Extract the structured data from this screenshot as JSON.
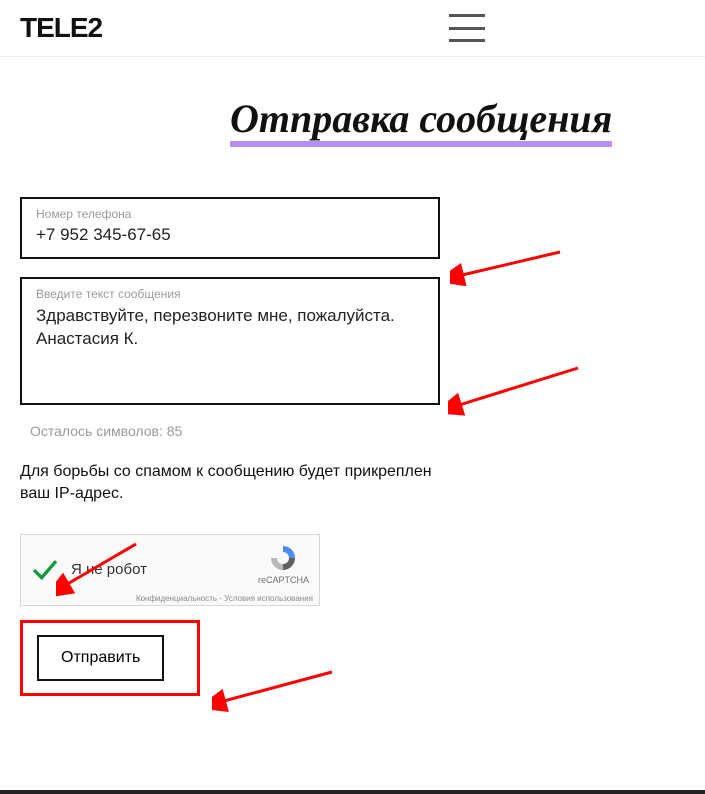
{
  "header": {
    "logo_text": "TELE2"
  },
  "page": {
    "title": "Отправка сообщения"
  },
  "form": {
    "phone_label": "Номер телефона",
    "phone_value": "+7 952 345-67-65",
    "message_label": "Введите текст сообщения",
    "message_value": "Здравствуйте, перезвоните мне, пожалуйста. Анастасия К.",
    "char_count_text": "Осталось символов: 85",
    "info_text": "Для борьбы со спамом к сообщению будет прикреплен ваш IP-адрес.",
    "submit_label": "Отправить"
  },
  "recaptcha": {
    "label": "Я не робот",
    "brand": "reCAPTCHA",
    "terms": "Конфиденциальность - Условия использования"
  }
}
